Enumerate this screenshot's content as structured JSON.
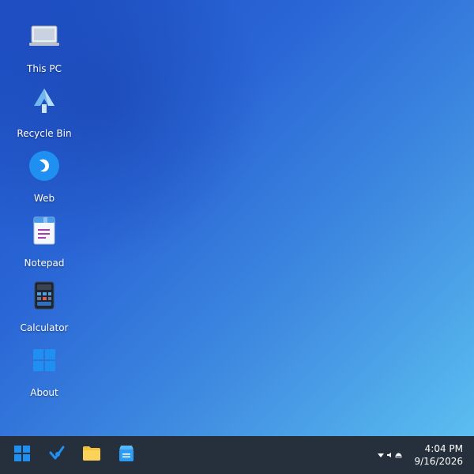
{
  "desktop": {
    "icons": [
      {
        "label": "This PC",
        "icon": "laptop-icon"
      },
      {
        "label": "Recycle Bin",
        "icon": "recycle-bin-icon"
      },
      {
        "label": "Web",
        "icon": "web-browser-icon"
      },
      {
        "label": "Notepad",
        "icon": "notepad-icon"
      },
      {
        "label": "Calculator",
        "icon": "calculator-icon"
      },
      {
        "label": "About",
        "icon": "windows-logo-icon"
      }
    ]
  },
  "taskbar": {
    "buttons": [
      {
        "icon": "start-menu-icon"
      },
      {
        "icon": "web-browser-icon"
      },
      {
        "icon": "file-explorer-icon"
      },
      {
        "icon": "store-icon"
      }
    ],
    "tray": {
      "icons": [
        "wifi-icon",
        "volume-icon",
        "battery-icon"
      ]
    },
    "clock": {
      "time": "4:04 PM",
      "date": "9/16/2026"
    }
  },
  "colors": {
    "taskbar": "#26303d",
    "desktop_gradient_start": "#1e4fc4",
    "desktop_gradient_end": "#5bbef0",
    "accent": "#1f8ff2",
    "folder": "#f5c33b"
  }
}
